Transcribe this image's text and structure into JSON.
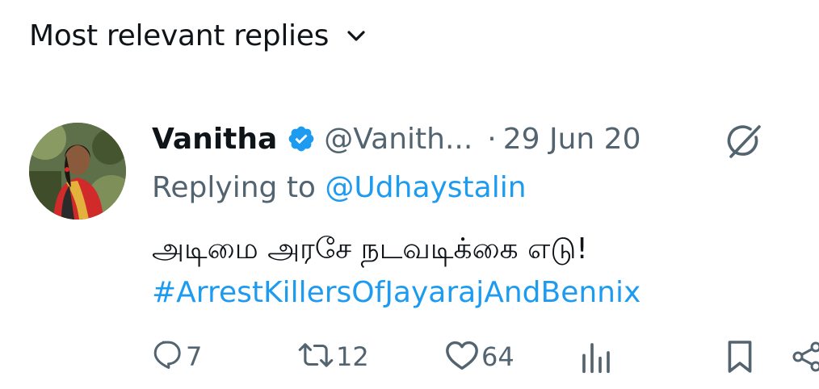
{
  "header": {
    "sort_label": "Most relevant replies",
    "chevron_icon": "chevron-down-icon"
  },
  "reply": {
    "display_name": "Vanitha",
    "verified_icon": "verified-badge-icon",
    "handle": "@Vanith...",
    "separator": "·",
    "date": "29 Jun 20",
    "grok_icon": "grok-icon",
    "replying_to_prefix": "Replying to",
    "replying_to_handle": "@Udhaystalin",
    "text": "அடிமை அரசே நடவடிக்கை எடு!",
    "hashtag": "#ArrestKillersOfJayarajAndBennix"
  },
  "actions": {
    "replies": "7",
    "reposts": "12",
    "likes": "64"
  },
  "colors": {
    "accent": "#1d9bf0",
    "secondary_text": "#536471",
    "primary_text": "#0f1419"
  }
}
